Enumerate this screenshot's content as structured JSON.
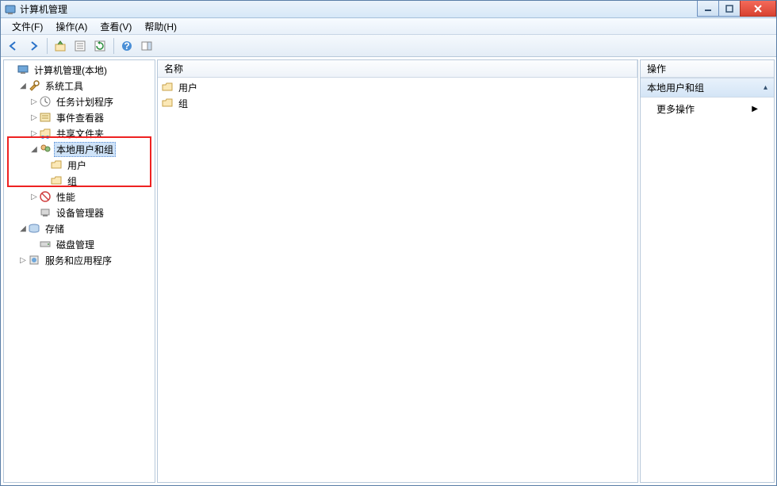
{
  "window": {
    "title": "计算机管理"
  },
  "menubar": [
    "文件(F)",
    "操作(A)",
    "查看(V)",
    "帮助(H)"
  ],
  "tree": {
    "root": "计算机管理(本地)",
    "system_tools": "系统工具",
    "task_scheduler": "任务计划程序",
    "event_viewer": "事件查看器",
    "shared_folders": "共享文件夹",
    "local_users_groups": "本地用户和组",
    "users": "用户",
    "groups": "组",
    "performance": "性能",
    "device_manager": "设备管理器",
    "storage": "存储",
    "disk_management": "磁盘管理",
    "services_apps": "服务和应用程序"
  },
  "list": {
    "header": "名称",
    "items": [
      "用户",
      "组"
    ]
  },
  "actions": {
    "header": "操作",
    "section": "本地用户和组",
    "more": "更多操作"
  }
}
